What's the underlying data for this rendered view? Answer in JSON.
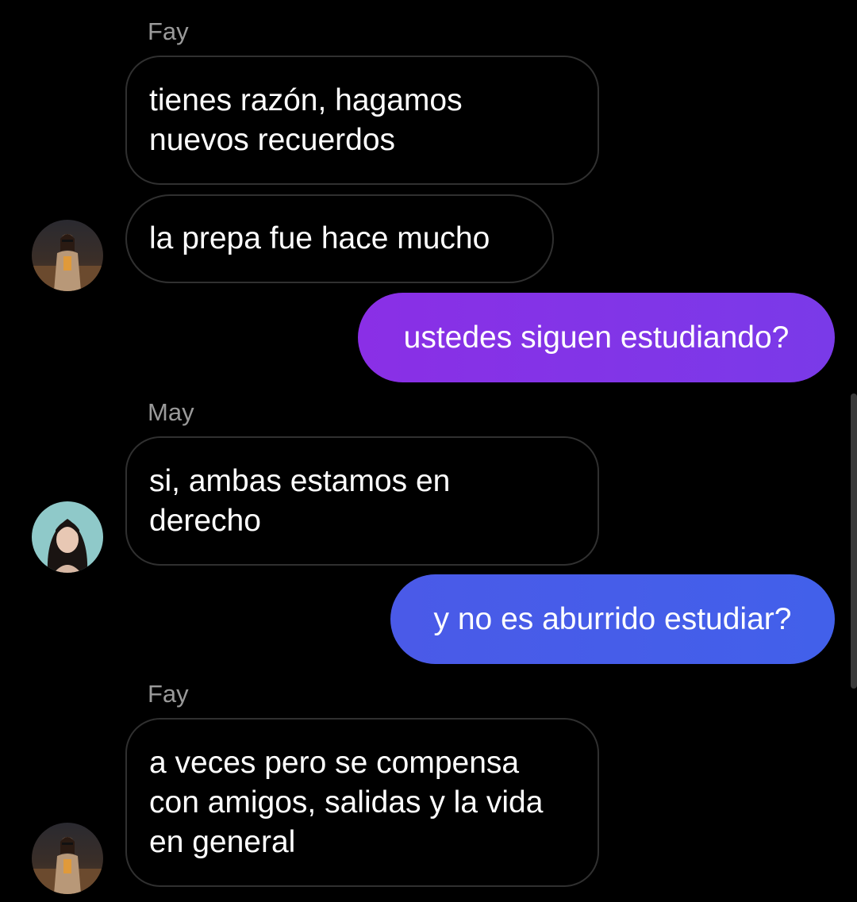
{
  "colors": {
    "background": "#000000",
    "incoming_border": "#303030",
    "sender_name": "#9a9a9a",
    "outgoing_gradient_1": "#8a2fe6",
    "outgoing_gradient_2": "#4260ea"
  },
  "messages": [
    {
      "type": "sender",
      "name": "Fay"
    },
    {
      "type": "incoming",
      "text": "tienes razón, hagamos\nnuevos recuerdos"
    },
    {
      "type": "incoming",
      "text": "la prepa fue hace mucho",
      "avatar": "avatar-icon-fay"
    },
    {
      "type": "outgoing",
      "text": "ustedes siguen estudiando?"
    },
    {
      "type": "sender",
      "name": "May"
    },
    {
      "type": "incoming",
      "text": "si, ambas estamos en\nderecho",
      "avatar": "avatar-icon-may"
    },
    {
      "type": "outgoing",
      "text": "y no es aburrido estudiar?"
    },
    {
      "type": "sender",
      "name": "Fay"
    },
    {
      "type": "incoming",
      "text": "a veces pero se compensa\ncon amigos, salidas y la vida\nen general",
      "avatar": "avatar-icon-fay"
    }
  ]
}
